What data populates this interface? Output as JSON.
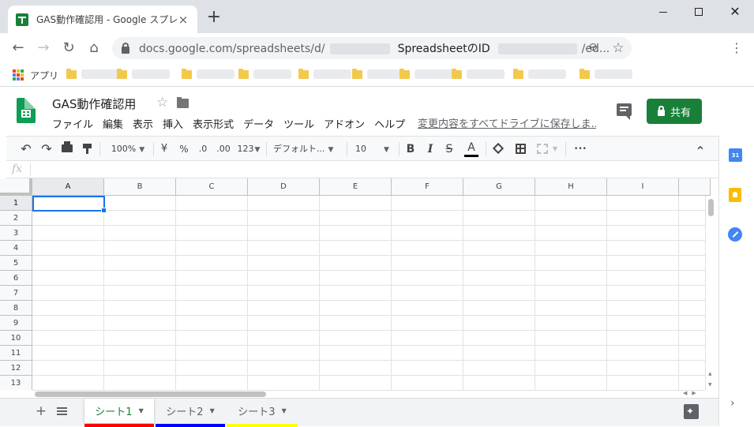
{
  "browser": {
    "tab_title": "GAS動作確認用 - Google スプレッドシート",
    "tab_close": "×",
    "new_tab": "+",
    "url_prefix": "docs.google.com/spreadsheets/d/",
    "url_id": "SpreadsheetのID",
    "url_suffix": "/ed...",
    "bookmarks_apps_label": "アプリ",
    "nav_back": "←",
    "nav_forward": "→",
    "nav_reload": "↻",
    "nav_home": "⌂",
    "zoom_glyph": "⊖",
    "star_glyph": "☆",
    "menu_glyph": "⋮",
    "close_glyph": "✕"
  },
  "header": {
    "doc_title": "GAS動作確認用",
    "star_glyph": "☆",
    "menu": [
      "ファイル",
      "編集",
      "表示",
      "挿入",
      "表示形式",
      "データ",
      "ツール",
      "アドオン",
      "ヘルプ"
    ],
    "save_status": "変更内容をすべてドライブに保存しま...",
    "share_label": "共有"
  },
  "toolbar": {
    "undo": "↶",
    "redo": "↷",
    "zoom": "100%",
    "currency": "¥",
    "percent": "%",
    "decimal_decrease": ".0",
    "decimal_increase": ".00",
    "more_formats": "123",
    "font": "デフォルト...",
    "font_size": "10",
    "bold": "B",
    "italic": "I",
    "strikethrough": "S",
    "text_color": "A",
    "more": "•••",
    "collapse": "⌃",
    "caret": "▼"
  },
  "formula_bar": {
    "fx": "fx"
  },
  "grid": {
    "columns": [
      "A",
      "B",
      "C",
      "D",
      "E",
      "F",
      "G",
      "H",
      "I"
    ],
    "rows": [
      "1",
      "2",
      "3",
      "4",
      "5",
      "6",
      "7",
      "8",
      "9",
      "10",
      "11",
      "12",
      "13"
    ],
    "selected_cell": "A1"
  },
  "sheets": {
    "tabs": [
      {
        "label": "シート1",
        "color": "#ff0000",
        "active": true
      },
      {
        "label": "シート2",
        "color": "#0000ff",
        "active": false
      },
      {
        "label": "シート3",
        "color": "#ffff00",
        "active": false
      }
    ],
    "add_glyph": "+",
    "caret": "▼"
  },
  "side_panel": {
    "calendar_label": "31",
    "expand_glyph": "›"
  },
  "colors": {
    "accent_green": "#188038",
    "selection_blue": "#1a73e8"
  }
}
